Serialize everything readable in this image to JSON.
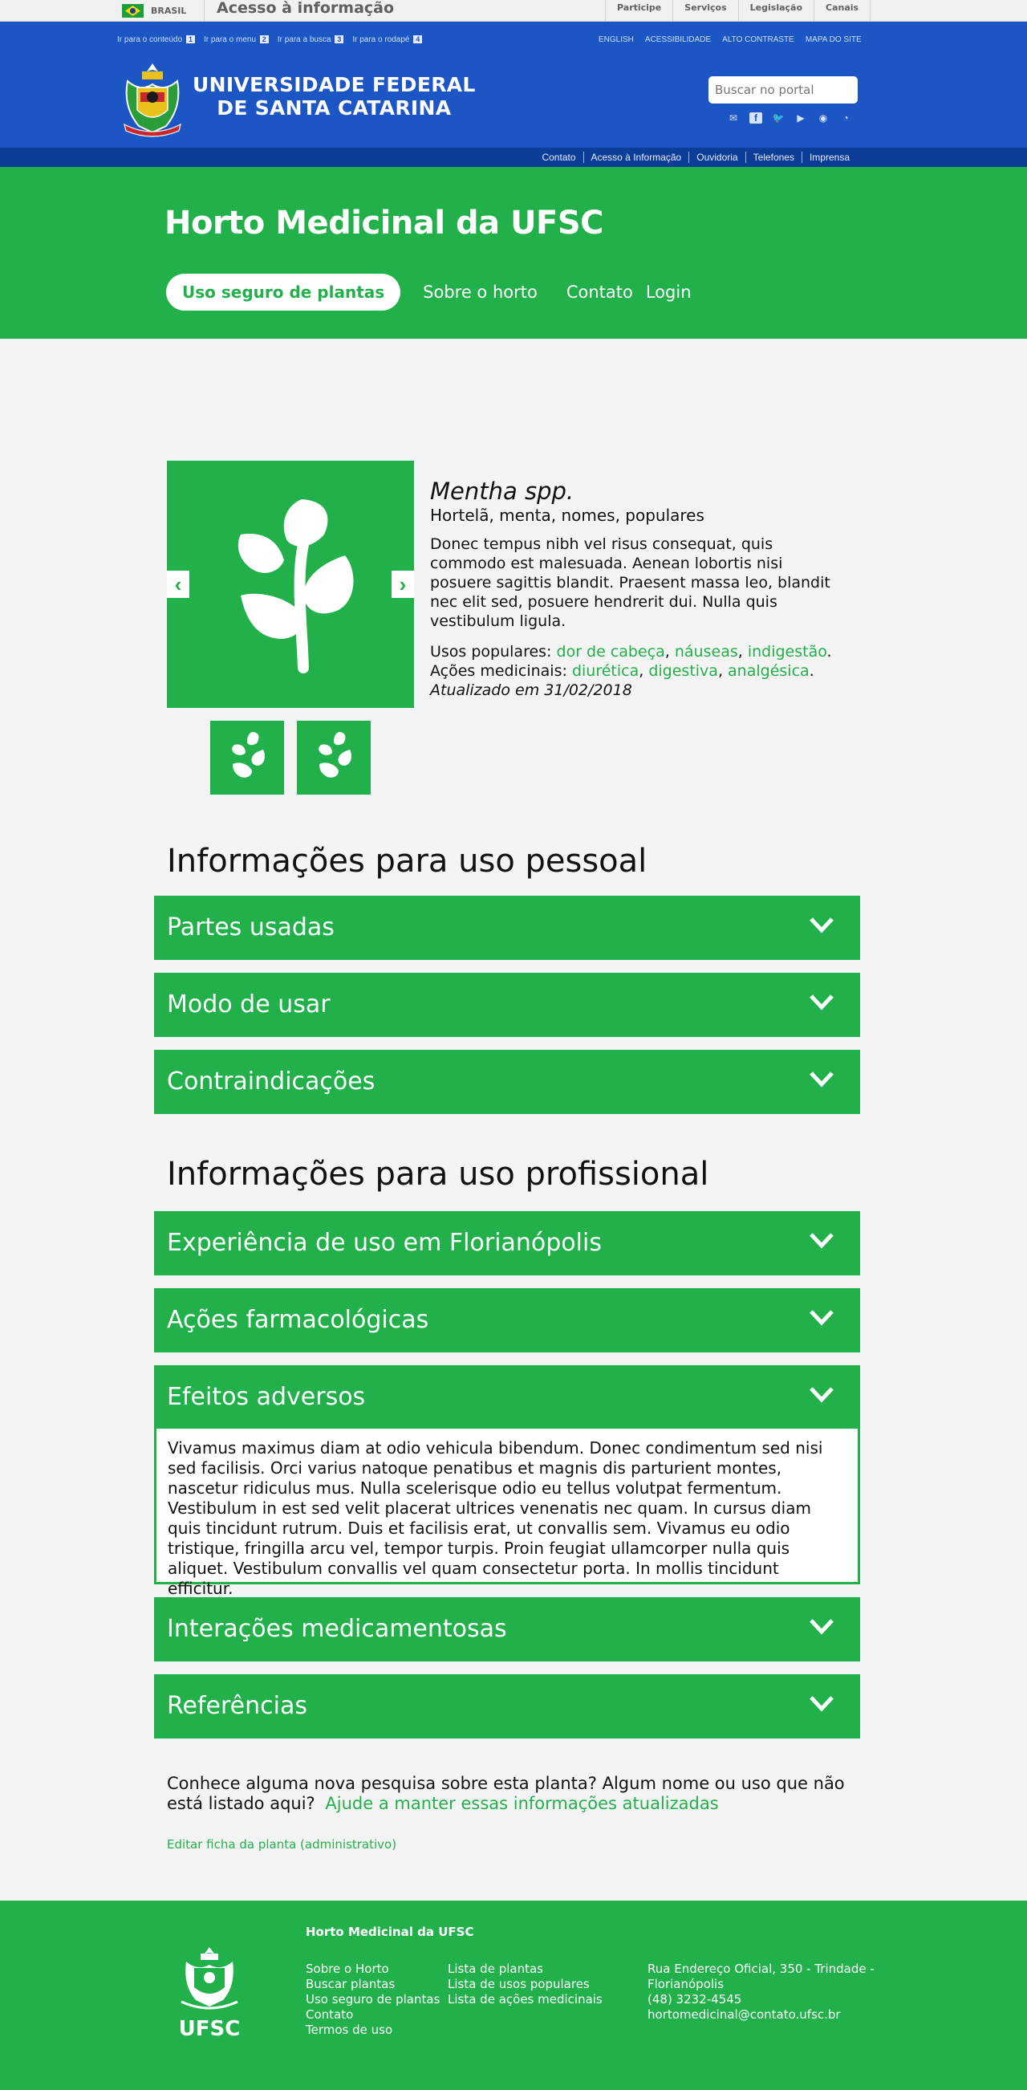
{
  "govbar": {
    "country": "BRASIL",
    "access_info": "Acesso à informação",
    "links": [
      "Participe",
      "Serviços",
      "Legislação",
      "Canais"
    ]
  },
  "header": {
    "skip_links": [
      {
        "label": "Ir para o conteúdo",
        "key": "1"
      },
      {
        "label": "Ir para o menu",
        "key": "2"
      },
      {
        "label": "Ir para a busca",
        "key": "3"
      },
      {
        "label": "Ir para o rodapé",
        "key": "4"
      }
    ],
    "tools": [
      "ENGLISH",
      "ACESSIBILIDADE",
      "ALTO CONTRASTE",
      "MAPA DO SITE"
    ],
    "university_line1": "UNIVERSIDADE FEDERAL",
    "university_line2": "DE SANTA CATARINA",
    "search_placeholder": "Buscar no portal",
    "social_icons": [
      "mail-icon",
      "facebook-icon",
      "twitter-icon",
      "youtube-icon",
      "instagram-icon",
      "rss-icon"
    ],
    "subnav": [
      "Contato",
      "Acesso à Informação",
      "Ouvidoria",
      "Telefones",
      "Imprensa"
    ]
  },
  "hero": {
    "title": "Horto Medicinal da UFSC",
    "nav": {
      "active": "Uso seguro de plantas",
      "items": [
        "Sobre o horto",
        "Contato",
        "Login"
      ]
    }
  },
  "plant": {
    "scientific_name": "Mentha spp.",
    "common_names": "Hortelã, menta, nomes, populares",
    "description": "Donec tempus nibh vel risus consequat, quis commodo est malesuada. Aenean lobortis nisi posuere sagittis blandit. Praesent massa leo, blandit nec elit sed, posuere hendrerit dui. Nulla quis vestibulum ligula.",
    "popular_uses_label": "Usos populares:",
    "popular_uses": [
      "dor de cabeça",
      "náuseas",
      "indigestão"
    ],
    "medicinal_actions_label": "Ações medicinais:",
    "medicinal_actions": [
      "diurética",
      "digestiva",
      "analgésica"
    ],
    "updated": "Atualizado em 31/02/2018"
  },
  "personal": {
    "title": "Informações para uso pessoal",
    "items": [
      "Partes usadas",
      "Modo de usar",
      "Contraindicações"
    ]
  },
  "professional": {
    "title": "Informações para uso profissional",
    "items": [
      "Experiência de uso em Florianópolis",
      "Ações farmacológicas",
      "Efeitos adversos",
      "Interações medicamentosas",
      "Referências"
    ],
    "expanded_text": "Vivamus maximus diam at odio vehicula bibendum. Donec condimentum sed nisi sed facilisis. Orci varius natoque penatibus et magnis dis parturient montes, nascetur ridiculus mus. Nulla scelerisque odio eu tellus volutpat fermentum. Vestibulum in est sed velit placerat ultrices venenatis nec quam. In cursus diam quis tincidunt rutrum. Duis et facilisis erat, ut convallis sem. Vivamus eu odio tristique, fringilla arcu vel, tempor turpis. Proin feugiat ullamcorper nulla quis aliquet. Vestibulum convallis vel quam consectetur porta. In mollis tincidunt efficitur."
  },
  "cta": {
    "text": "Conhece alguma nova pesquisa sobre esta planta? Algum nome ou uso que não está listado aqui?",
    "link": "Ajude a manter essas informações atualizadas",
    "admin": "Editar ficha da planta (administrativo)"
  },
  "footer": {
    "title": "Horto Medicinal da UFSC",
    "logo_text": "UFSC",
    "col1": [
      "Sobre o Horto",
      "Buscar plantas",
      "Uso seguro de plantas",
      "Contato",
      "Termos de uso"
    ],
    "col2": [
      "Lista de plantas",
      "Lista de usos populares",
      "Lista de ações medicinais"
    ],
    "address": [
      "Rua Endereço Oficial, 350 - Trindade -",
      "Florianópolis",
      "(48) 3232-4545",
      "hortomedicinal@contato.ufsc.br"
    ]
  },
  "colors": {
    "green": "#22b04a",
    "blue": "#1c55c4",
    "dark_blue": "#0d3c99"
  }
}
